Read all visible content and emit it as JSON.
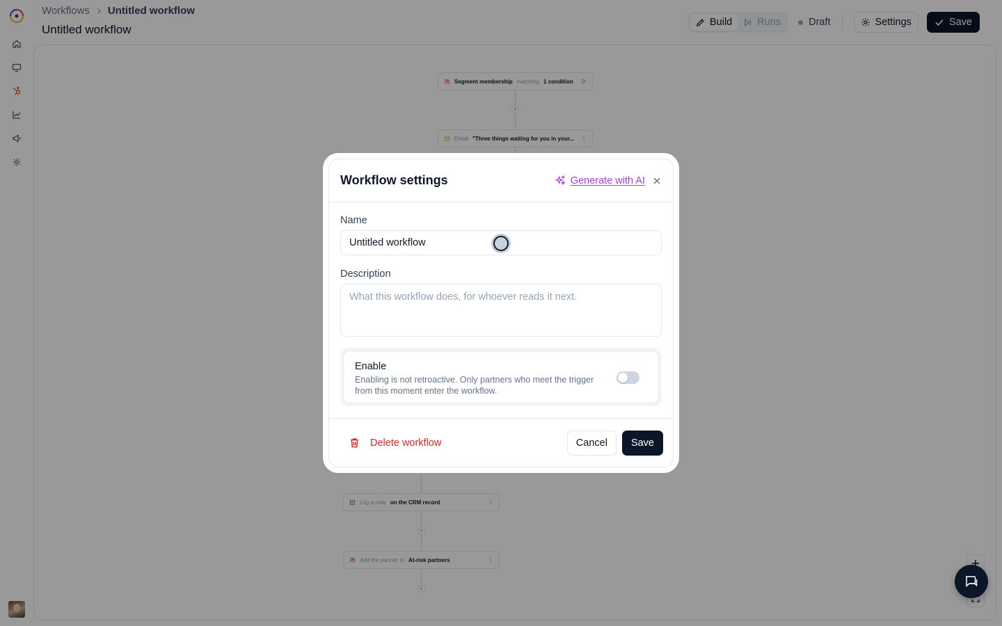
{
  "breadcrumb": {
    "root": "Workflows",
    "current": "Untitled workflow"
  },
  "page_title": "Untitled workflow",
  "toolbar": {
    "build_label": "Build",
    "runs_label": "Runs",
    "status_label": "Draft",
    "settings_label": "Settings",
    "save_label": "Save"
  },
  "rail": {
    "icons": [
      "home-icon",
      "monitor-icon",
      "hubspot-icon",
      "chart-icon",
      "megaphone-icon",
      "gear-icon"
    ],
    "active": "hubspot-icon"
  },
  "canvas": {
    "nodes": [
      {
        "icon": "users-icon",
        "pre": "Segment membership",
        "mid": "matching",
        "bold": "1 condition"
      },
      {
        "icon": "mail-icon",
        "pre": "Email",
        "bold": "\"Three things waiting for you in your..."
      },
      {
        "icon": "note-icon",
        "pre": "Log a note",
        "bold": "on the CRM record"
      },
      {
        "icon": "users-icon",
        "pre": "Add the partner to",
        "bold": "At-risk partners"
      }
    ],
    "plus": "+"
  },
  "modal": {
    "title": "Workflow settings",
    "ai_link": "Generate with AI",
    "name_label": "Name",
    "name_value": "Untitled workflow",
    "description_label": "Description",
    "description_placeholder": "What this workflow does, for whoever reads it next.",
    "enable_title": "Enable",
    "enable_desc": "Enabling is not retroactive. Only partners who meet the trigger from this moment enter the workflow.",
    "enable_on": false,
    "delete_label": "Delete workflow",
    "cancel_label": "Cancel",
    "save_label": "Save"
  },
  "colors": {
    "primary_dark": "#0b1628",
    "ai_accent": "#a23fd6",
    "danger": "#dc2626",
    "rail_active": "#e8553d"
  }
}
